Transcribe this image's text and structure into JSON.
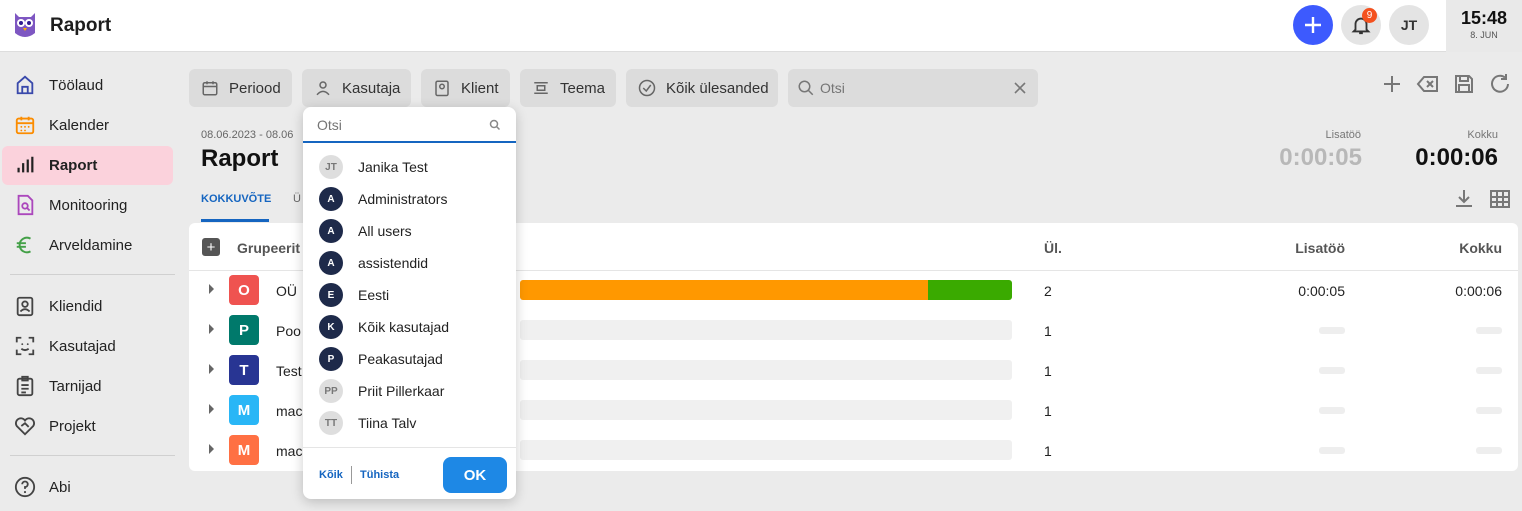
{
  "app": {
    "title": "Raport"
  },
  "topbar": {
    "notifications_count": "9",
    "user_initials": "JT",
    "time": "15:48",
    "date": "8. JUN",
    "accent_color": "#3d5afe"
  },
  "sidebar": {
    "items": [
      {
        "label": "Töölaud",
        "icon": "home-icon"
      },
      {
        "label": "Kalender",
        "icon": "calendar-icon"
      },
      {
        "label": "Raport",
        "icon": "bar-chart-icon",
        "active": true
      },
      {
        "label": "Monitooring",
        "icon": "monitor-doc-icon"
      },
      {
        "label": "Arveldamine",
        "icon": "euro-icon"
      },
      {
        "label": "Kliendid",
        "icon": "contact-card-icon"
      },
      {
        "label": "Kasutajad",
        "icon": "face-scan-icon"
      },
      {
        "label": "Tarnijad",
        "icon": "clipboard-icon"
      },
      {
        "label": "Projekt",
        "icon": "handshake-icon"
      },
      {
        "label": "Abi",
        "icon": "help-icon"
      }
    ]
  },
  "filters": {
    "periood": "Periood",
    "kasutaja": "Kasutaja",
    "klient": "Klient",
    "teema": "Teema",
    "ulesanded": "Kõik ülesanded",
    "search_placeholder": "Otsi"
  },
  "report": {
    "date_range": "08.06.2023 - 08.06",
    "title": "Raport",
    "lisatoo_label": "Lisatöö",
    "lisatoo_value": "0:00:05",
    "kokku_label": "Kokku",
    "kokku_value": "0:00:06",
    "tab_active": "KOKKUVÕTE",
    "tab_other": "Ü"
  },
  "table": {
    "group_label": "Grupeerit",
    "col_ul": "Ül.",
    "col_lisatoo": "Lisatöö",
    "col_kokku": "Kokku",
    "rows": [
      {
        "letter": "O",
        "color": "#ef5350",
        "name": "OÜ",
        "count": "2",
        "lisatoo": "0:00:05",
        "kokku": "0:00:06",
        "bar": [
          {
            "value": 0.83,
            "color": "#ff9800"
          },
          {
            "value": 0.17,
            "color": "#3aaa00"
          }
        ]
      },
      {
        "letter": "P",
        "color": "#00796b",
        "name": "Poo",
        "count": "1",
        "lisatoo": "",
        "kokku": "",
        "bar": []
      },
      {
        "letter": "T",
        "color": "#283593",
        "name": "Test",
        "count": "1",
        "lisatoo": "",
        "kokku": "",
        "bar": []
      },
      {
        "letter": "M",
        "color": "#29b6f6",
        "name": "mac",
        "count": "1",
        "lisatoo": "",
        "kokku": "",
        "bar": []
      },
      {
        "letter": "M",
        "color": "#ff7043",
        "name": "mac",
        "count": "1",
        "lisatoo": "",
        "kokku": "",
        "bar": []
      }
    ]
  },
  "dropdown": {
    "search_placeholder": "Otsi",
    "items": [
      {
        "initials": "JT",
        "label": "Janika Test",
        "kind": "user"
      },
      {
        "initials": "A",
        "label": "Administrators",
        "kind": "group"
      },
      {
        "initials": "A",
        "label": "All users",
        "kind": "group"
      },
      {
        "initials": "A",
        "label": "assistendid",
        "kind": "group"
      },
      {
        "initials": "E",
        "label": "Eesti",
        "kind": "group"
      },
      {
        "initials": "K",
        "label": "Kõik kasutajad",
        "kind": "group"
      },
      {
        "initials": "P",
        "label": "Peakasutajad",
        "kind": "group"
      },
      {
        "initials": "PP",
        "label": "Priit Pillerkaar",
        "kind": "user"
      },
      {
        "initials": "TT",
        "label": "Tiina Talv",
        "kind": "user"
      }
    ],
    "all_label": "Kõik",
    "clear_label": "Tühista",
    "ok_label": "OK"
  }
}
